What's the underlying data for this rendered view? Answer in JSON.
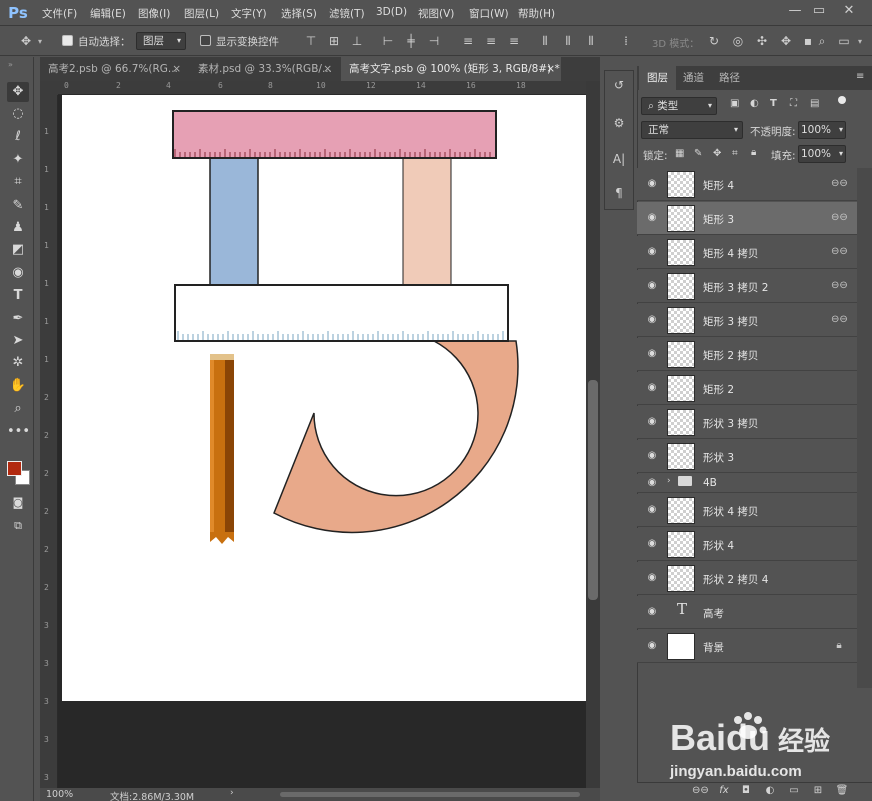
{
  "app": {
    "logo": "Ps"
  },
  "menu": [
    "文件(F)",
    "编辑(E)",
    "图像(I)",
    "图层(L)",
    "文字(Y)",
    "选择(S)",
    "滤镜(T)",
    "3D(D)",
    "视图(V)",
    "窗口(W)",
    "帮助(H)"
  ],
  "window_controls": {
    "minimize": "—",
    "restore": "▭",
    "close": "✕"
  },
  "options": {
    "auto_select_label": "自动选择：",
    "auto_select_value": "图层",
    "show_transform_label": "显示变换控件",
    "mode3d_label": "3D 模式："
  },
  "tabs": [
    {
      "label": "高考2.psb @ 66.7%(RG...",
      "close": "×"
    },
    {
      "label": "素材.psd @ 33.3%(RGB/...",
      "close": "×"
    },
    {
      "label": "高考文字.psb @ 100% (矩形 3, RGB/8#) *",
      "close": "×"
    }
  ],
  "ruler_top": [
    "0",
    "2",
    "4",
    "6",
    "8",
    "10",
    "12",
    "14",
    "16",
    "18"
  ],
  "ruler_left": [
    "1",
    "1",
    "1",
    "1",
    "1",
    "1",
    "1",
    "2",
    "2",
    "2",
    "2",
    "2",
    "2",
    "3",
    "3",
    "3",
    "3",
    "3"
  ],
  "statusbar": {
    "zoom": "100%",
    "doc": "文档:2.86M/3.30M"
  },
  "layers_panel": {
    "tabs": [
      "图层",
      "通道",
      "路径"
    ],
    "filter_label": "类型",
    "blend_mode": "正常",
    "opacity_label": "不透明度:",
    "opacity_value": "100%",
    "lock_label": "锁定:",
    "fill_label": "填充:",
    "fill_value": "100%",
    "layers": [
      {
        "name": "矩形 4",
        "linked": true,
        "selected": false,
        "kind": "shape"
      },
      {
        "name": "矩形 3",
        "linked": true,
        "selected": true,
        "kind": "shape"
      },
      {
        "name": "矩形 4 拷贝",
        "linked": true,
        "selected": false,
        "kind": "shape"
      },
      {
        "name": "矩形 3 拷贝 2",
        "linked": true,
        "selected": false,
        "kind": "shape"
      },
      {
        "name": "矩形 3 拷贝",
        "linked": true,
        "selected": false,
        "kind": "shape"
      },
      {
        "name": "矩形 2 拷贝",
        "linked": false,
        "selected": false,
        "kind": "shape"
      },
      {
        "name": "矩形 2",
        "linked": false,
        "selected": false,
        "kind": "shape"
      },
      {
        "name": "形状 3 拷贝",
        "linked": false,
        "selected": false,
        "kind": "shape"
      },
      {
        "name": "形状 3",
        "linked": false,
        "selected": false,
        "kind": "shape"
      }
    ],
    "group": {
      "name": "4B"
    },
    "layers2": [
      {
        "name": "形状 4 拷贝",
        "kind": "shape"
      },
      {
        "name": "形状 4",
        "kind": "shape"
      },
      {
        "name": "形状 2 拷贝 4",
        "kind": "shape"
      }
    ],
    "text_layer": {
      "name": "高考",
      "icon": "T"
    },
    "background_layer": {
      "name": "背景"
    }
  },
  "watermark": {
    "brand": "Baidu",
    "cn": "经验",
    "url": "jingyan.baidu.com"
  },
  "colors": {
    "pink": "#e6a0b4",
    "blue": "#9ab7d9",
    "peach": "#f0cbb8",
    "salmon": "#e8a98a",
    "orange": "#c8700f",
    "fg_color": "#b22a10"
  }
}
